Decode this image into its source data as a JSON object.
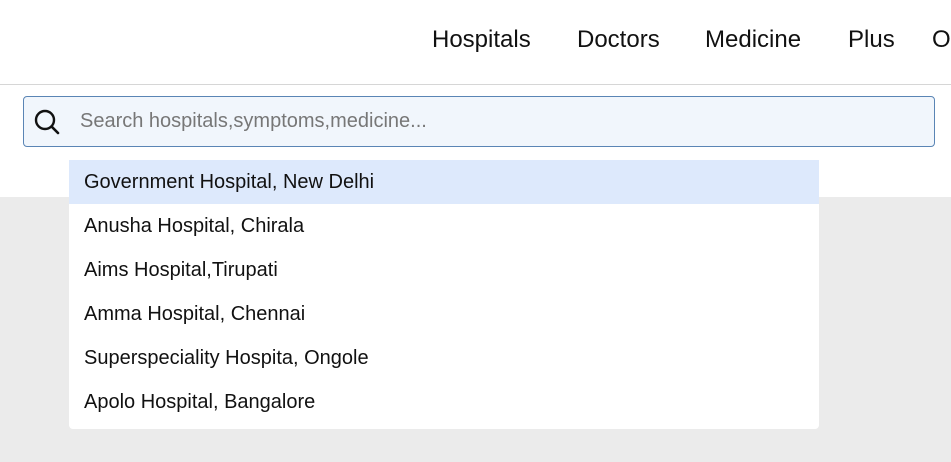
{
  "nav": {
    "items": [
      {
        "label": "Hospitals"
      },
      {
        "label": "Doctors"
      },
      {
        "label": "Medicine"
      },
      {
        "label": "Plus"
      },
      {
        "label": "O"
      }
    ]
  },
  "search": {
    "placeholder": "Search hospitals,symptoms,medicine...",
    "value": "",
    "icon": "search-icon"
  },
  "suggestions": {
    "items": [
      {
        "label": "Government Hospital, New Delhi",
        "highlighted": true
      },
      {
        "label": "Anusha Hospital, Chirala",
        "highlighted": false
      },
      {
        "label": "Aims Hospital,Tirupati",
        "highlighted": false
      },
      {
        "label": "Amma Hospital, Chennai",
        "highlighted": false
      },
      {
        "label": "Superspeciality Hospita, Ongole",
        "highlighted": false
      },
      {
        "label": "Apolo Hospital, Bangalore",
        "highlighted": false
      }
    ]
  },
  "colors": {
    "highlight": "#dde9fc",
    "search_border": "#5a85b5",
    "search_bg": "#f1f6fc",
    "page_gray": "#ebebeb"
  }
}
